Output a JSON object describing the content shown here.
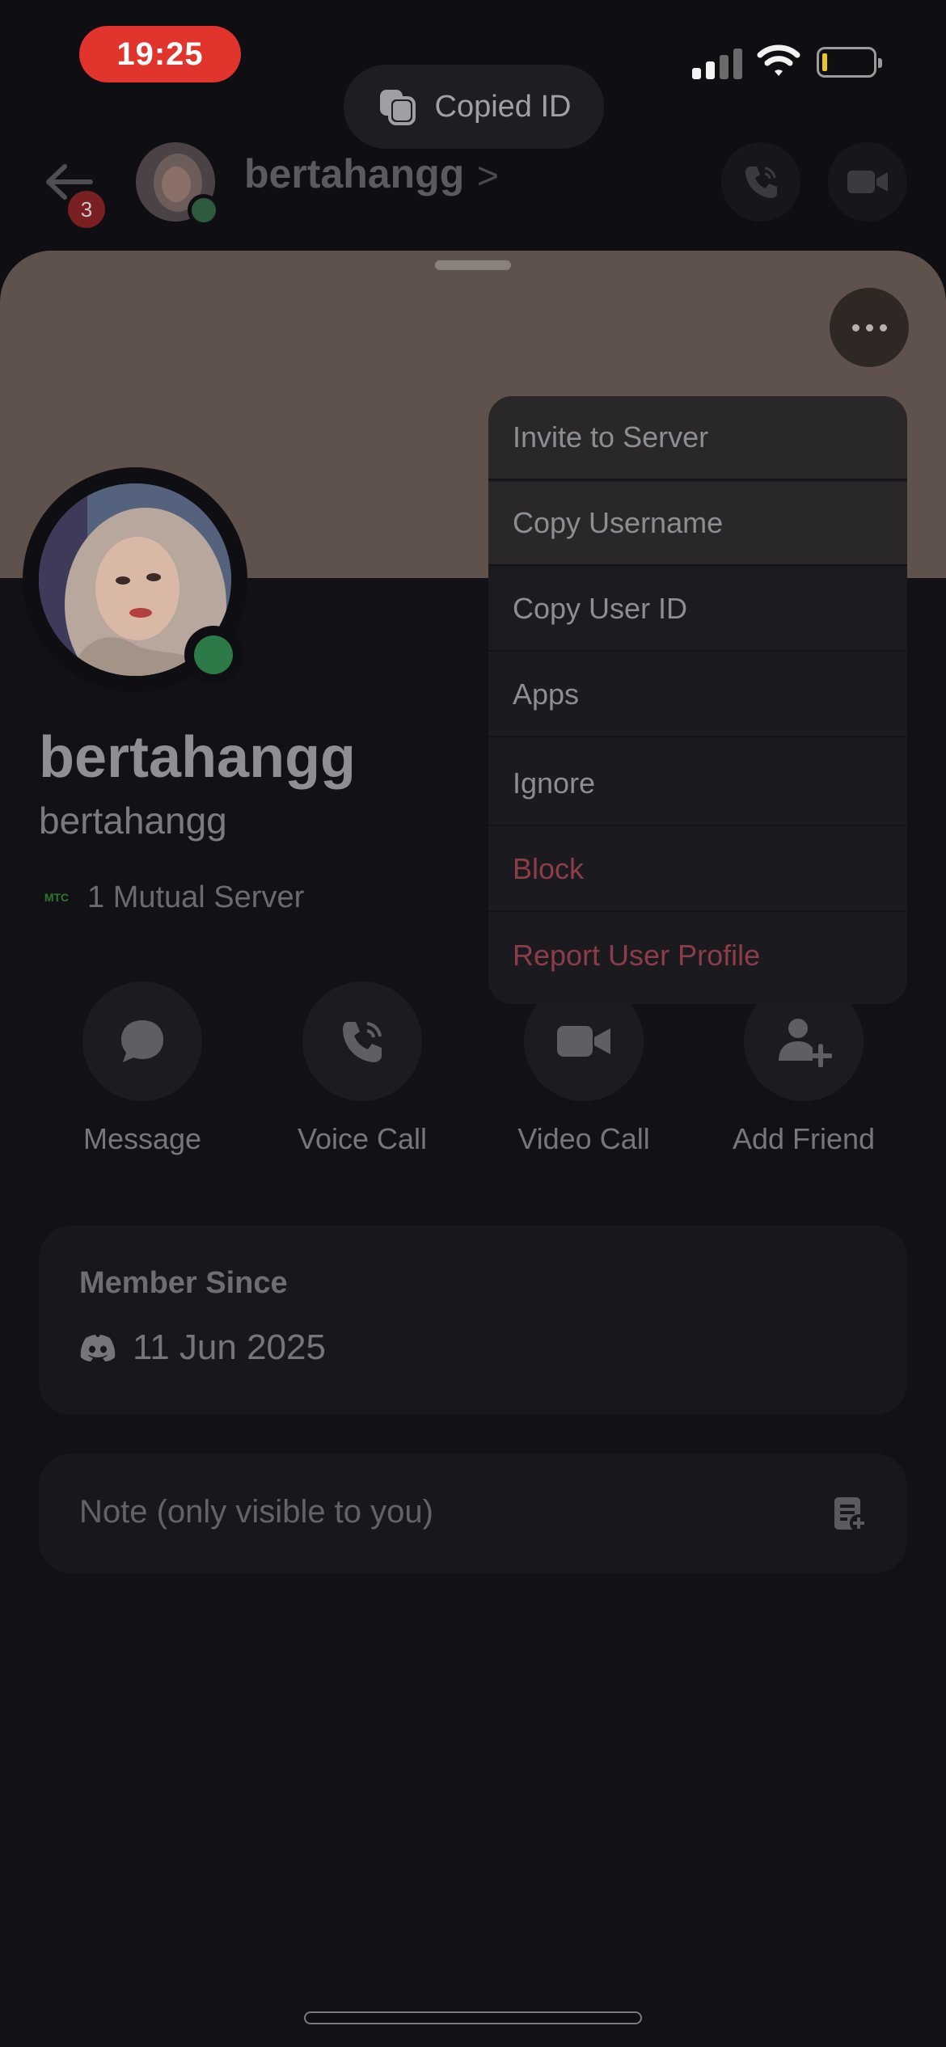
{
  "status_bar": {
    "time": "19:25",
    "battery_color": "#e6c626"
  },
  "toast": {
    "label": "Copied ID",
    "icon": "copy-icon"
  },
  "header": {
    "back_icon": "arrow-left-icon",
    "badge_count": "3",
    "name": "bertahangg",
    "chevron": ">",
    "voice_icon": "phone-call-icon",
    "video_icon": "video-camera-icon"
  },
  "profile": {
    "banner_color": "#5f524c",
    "display_name": "bertahangg",
    "username": "bertahangg",
    "mutual_server_icon_text": "MTC",
    "mutual_servers": "1 Mutual Server",
    "status_color": "#2c7a47"
  },
  "actions": [
    {
      "label": "Message",
      "icon": "chat-bubble-icon"
    },
    {
      "label": "Voice Call",
      "icon": "phone-call-icon"
    },
    {
      "label": "Video Call",
      "icon": "video-camera-icon"
    },
    {
      "label": "Add Friend",
      "icon": "add-person-icon"
    }
  ],
  "member_since": {
    "title": "Member Since",
    "date": "11 Jun 2025",
    "icon": "discord-icon"
  },
  "note": {
    "placeholder": "Note (only visible to you)",
    "icon": "note-add-icon"
  },
  "menu": {
    "items": [
      {
        "label": "Invite to Server"
      },
      {
        "label": "Copy Username"
      },
      {
        "label": "Copy User ID"
      },
      {
        "label": "Apps"
      },
      {
        "label": "Ignore"
      },
      {
        "label": "Block"
      },
      {
        "label": "Report User Profile"
      }
    ],
    "danger_color": "#8c3d47"
  }
}
